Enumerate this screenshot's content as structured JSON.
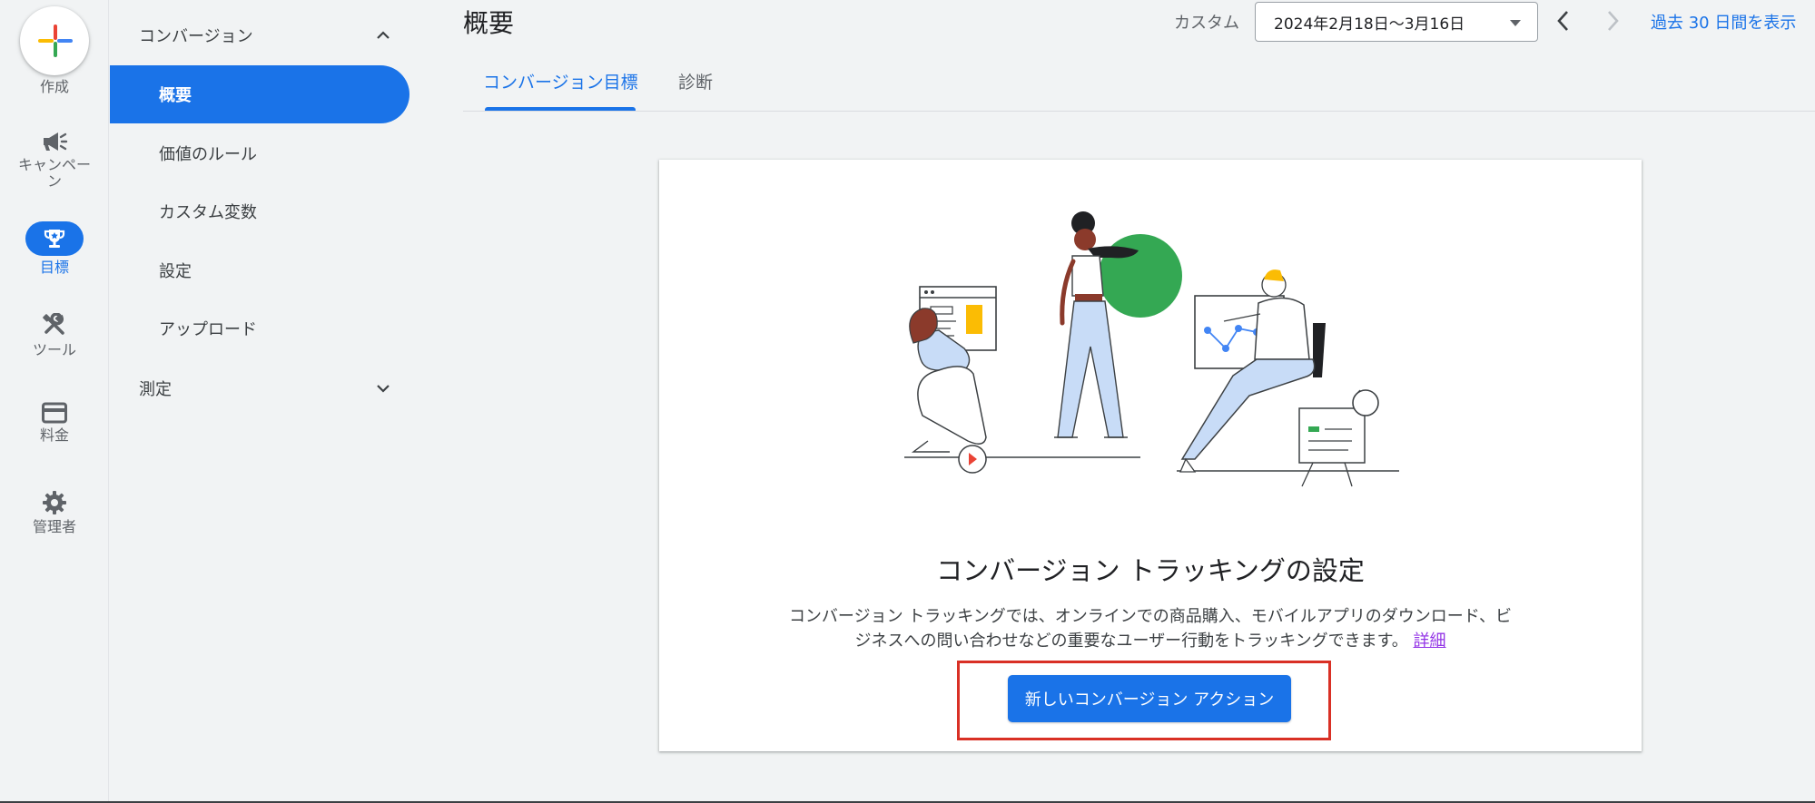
{
  "rail": {
    "create_label": "作成",
    "items": [
      {
        "label": "キャンペーン",
        "icon": "megaphone-icon"
      },
      {
        "label": "目標",
        "icon": "trophy-icon",
        "active": true
      },
      {
        "label": "ツール",
        "icon": "tools-icon"
      },
      {
        "label": "料金",
        "icon": "credit-card-icon"
      },
      {
        "label": "管理者",
        "icon": "gear-icon"
      }
    ]
  },
  "subnav": {
    "group_conversions": "コンバージョン",
    "items": [
      "概要",
      "価値のルール",
      "カスタム変数",
      "設定",
      "アップロード"
    ],
    "active_item": "概要",
    "group_measurement": "測定"
  },
  "header": {
    "title": "概要",
    "date_label": "カスタム",
    "date_range": "2024年2月18日〜3月16日",
    "last30_label": "過去 30 日間を表示"
  },
  "tabs": [
    "コンバージョン目標",
    "診断"
  ],
  "card": {
    "title": "コンバージョン トラッキングの設定",
    "desc_line1": "コンバージョン トラッキングでは、オンラインでの商品購入、モバイルアプリのダウンロード、ビ",
    "desc_line2": "ジネスへの問い合わせなどの重要なユーザー行動をトラッキングできます。",
    "desc_link": "詳細",
    "button_label": "新しいコンバージョン アクション"
  },
  "colors": {
    "accent": "#1a73e8",
    "highlight": "#d93025",
    "link_visited": "#9334e6",
    "illustration_green": "#34a853",
    "illustration_yellow": "#fbbc04"
  }
}
